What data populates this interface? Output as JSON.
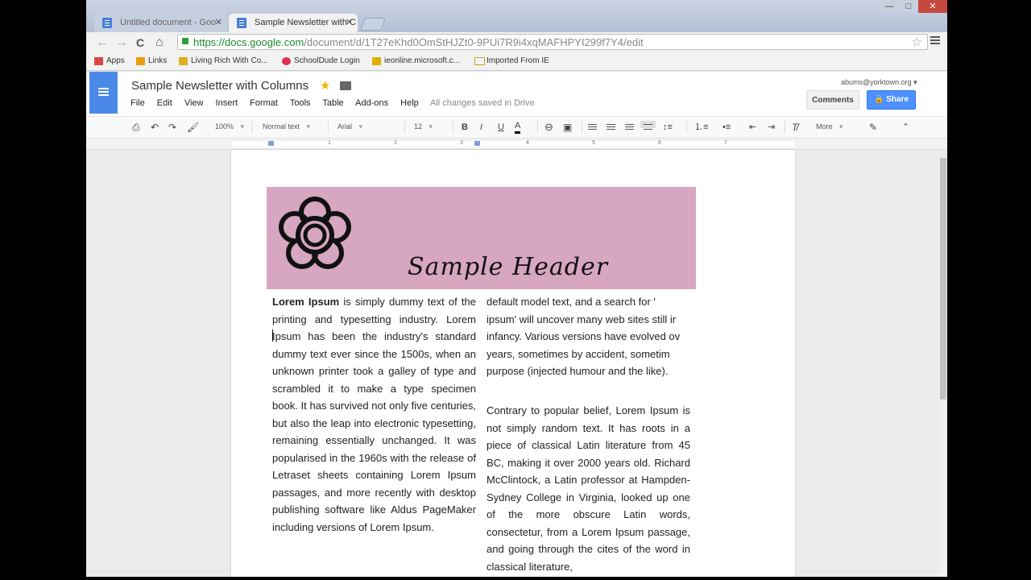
{
  "browser": {
    "tabs": [
      {
        "title": "Untitled document - Goo",
        "active": false
      },
      {
        "title": "Sample Newsletter with C",
        "active": true
      }
    ],
    "window_controls": {
      "minimize": "—",
      "maximize": "□",
      "close": "✕"
    },
    "nav": {
      "back": "←",
      "forward": "→",
      "reload": "C",
      "home": "⌂"
    },
    "url_host": "https://docs.google.com",
    "url_path": "/document/d/1T27eKhd0OmStHJZt0-9PUi7R9i4xqMAFHPYI299f7Y4/edit",
    "bookmarks": [
      {
        "label": "Apps",
        "color": "#d44"
      },
      {
        "label": "Links",
        "color": "#e8a010"
      },
      {
        "label": "Living Rich With Co...",
        "color": "#e0b020"
      },
      {
        "label": "SchoolDude Login",
        "color": "#d35"
      },
      {
        "label": "ieonline.microsoft.c...",
        "color": "#e0b000"
      },
      {
        "label": "Imported From IE",
        "color": "#e0b020"
      }
    ]
  },
  "docs": {
    "title": "Sample Newsletter with Columns",
    "menu": [
      "File",
      "Edit",
      "View",
      "Insert",
      "Format",
      "Tools",
      "Table",
      "Add-ons",
      "Help"
    ],
    "save_status": "All changes saved in Drive",
    "account": "abums@yorktown.org",
    "comments_label": "Comments",
    "share_label": "Share",
    "accent": "#4d90fe"
  },
  "format_toolbar": {
    "zoom": "100%",
    "style": "Normal text",
    "font": "Arial",
    "size": "12",
    "more": "More",
    "icons": [
      "print-icon",
      "undo-icon",
      "redo-icon",
      "paint-format-icon",
      "bold-icon",
      "italic-icon",
      "underline-icon",
      "text-color-icon",
      "link-icon",
      "comment-icon",
      "align-left-icon",
      "align-center-icon",
      "align-right-icon",
      "justify-icon",
      "line-spacing-icon",
      "numbered-list-icon",
      "bulleted-list-icon",
      "decrease-indent-icon",
      "increase-indent-icon",
      "clear-formatting-icon",
      "pencil-icon",
      "collapse-icon"
    ]
  },
  "ruler": {
    "numbers": [
      "1",
      "2",
      "3",
      "4",
      "5",
      "6",
      "7"
    ]
  },
  "document": {
    "header_text": "Sample Header",
    "header_color": "#d7a6c1",
    "col1_bold": "Lorem Ipsum",
    "col1_text": " is simply dummy text of the printing and typesetting industry. Lorem Ipsum has been the industry's standard dummy text ever since the 1500s, when an unknown printer took a galley of type and scrambled it to make a type specimen book. It has survived not only five centuries, but also the leap into electronic typesetting, remaining essentially unchanged. It was popularised in the 1960s with the release of Letraset sheets containing Lorem Ipsum passages, and more recently with desktop publishing software like Aldus PageMaker including versions of Lorem Ipsum.",
    "col2_lines": [
      "default model text, and a search for '",
      "ipsum' will uncover many web sites still ir",
      "infancy. Various versions have evolved ov",
      "years, sometimes by accident, sometim",
      "purpose (injected humour and the like)."
    ],
    "col3_text": "Contrary to popular belief, Lorem Ipsum is not simply random text. It has roots in a piece of classical Latin literature from 45 BC, making it over 2000 years old. Richard McClintock, a Latin professor at Hampden-Sydney College in Virginia, looked up one of the more obscure Latin words, consectetur, from a Lorem Ipsum passage, and going through the cites of the word in classical literature,"
  }
}
